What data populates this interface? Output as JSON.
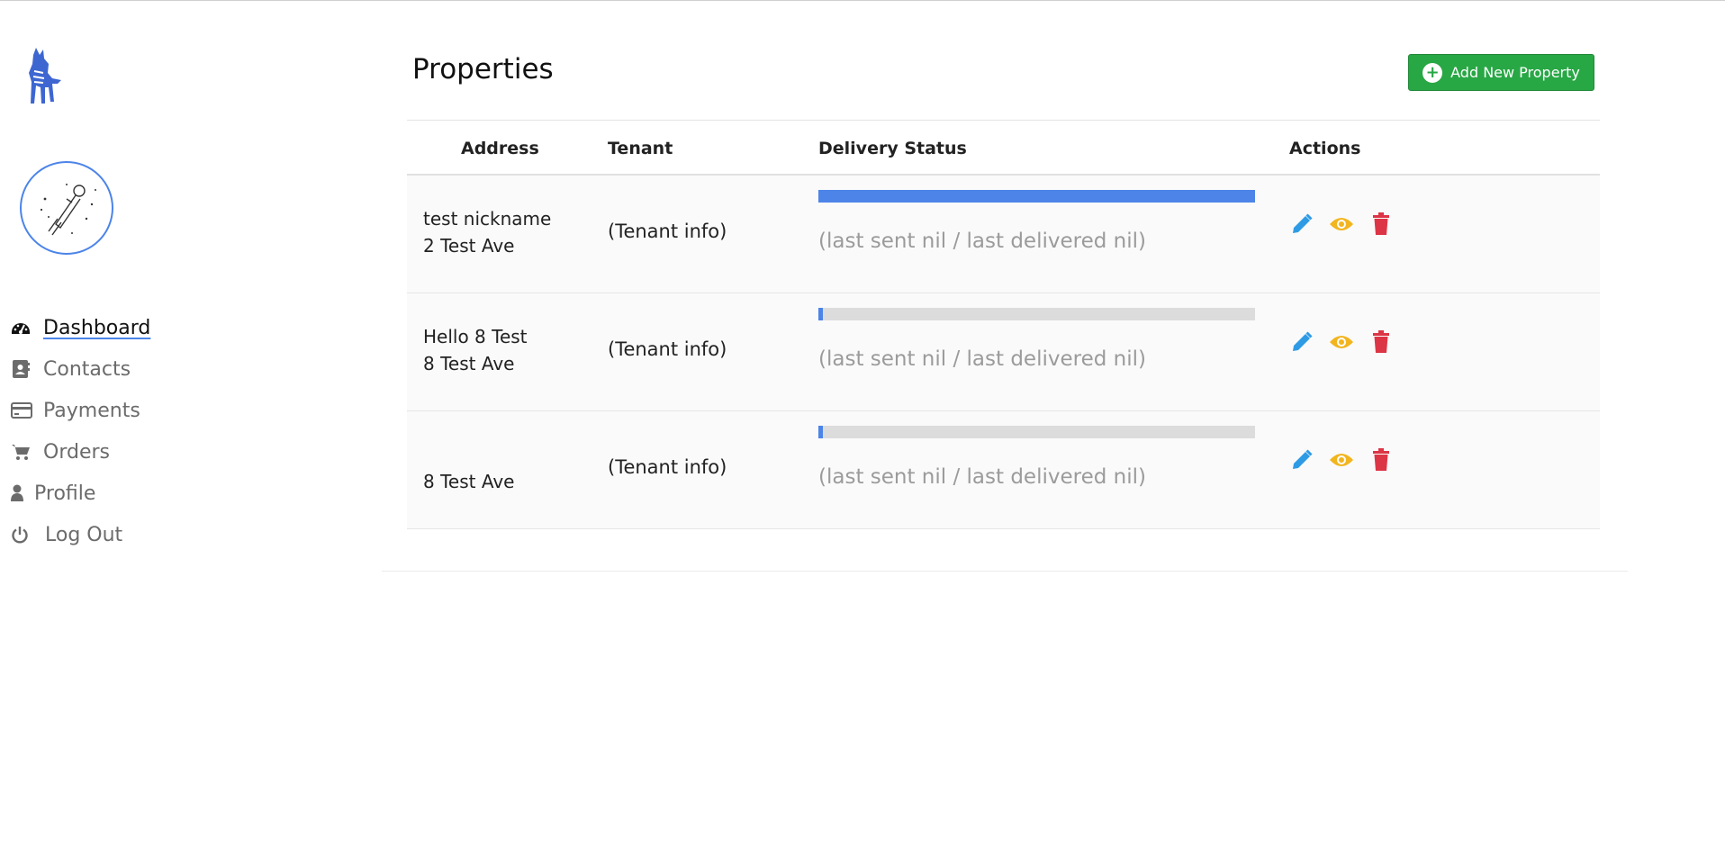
{
  "sidebar": {
    "nav": [
      {
        "label": "Dashboard",
        "icon": "dashboard-gauge-icon",
        "active": true
      },
      {
        "label": "Contacts",
        "icon": "address-book-icon"
      },
      {
        "label": "Payments",
        "icon": "credit-card-icon"
      },
      {
        "label": "Orders",
        "icon": "shopping-cart-icon"
      },
      {
        "label": "Profile",
        "icon": "user-icon"
      },
      {
        "label": "Log Out",
        "icon": "power-icon"
      }
    ]
  },
  "main": {
    "title": "Properties",
    "add_button_label": "Add New Property",
    "columns": [
      "Address",
      "Tenant",
      "Delivery Status",
      "Actions"
    ],
    "rows": [
      {
        "address_line1": "test nickname",
        "address_line2": "2 Test Ave",
        "tenant": "(Tenant info)",
        "progress_percent": 100,
        "status": "(last sent nil / last delivered nil)"
      },
      {
        "address_line1": "Hello 8 Test",
        "address_line2": "8 Test Ave",
        "tenant": "(Tenant info)",
        "progress_percent": 1,
        "status": "(last sent nil / last delivered nil)"
      },
      {
        "address_line1": "",
        "address_line2": "8 Test Ave",
        "tenant": "(Tenant info)",
        "progress_percent": 1,
        "status": "(last sent nil / last delivered nil)"
      }
    ]
  },
  "colors": {
    "accent": "#4c84e8",
    "success": "#28a745",
    "edit": "#2f9be5",
    "view": "#f2b51e",
    "delete": "#dc3545"
  },
  "icons": {
    "edit": "pencil-icon",
    "view": "eye-icon",
    "delete": "trash-icon",
    "add": "plus-circle-icon"
  }
}
